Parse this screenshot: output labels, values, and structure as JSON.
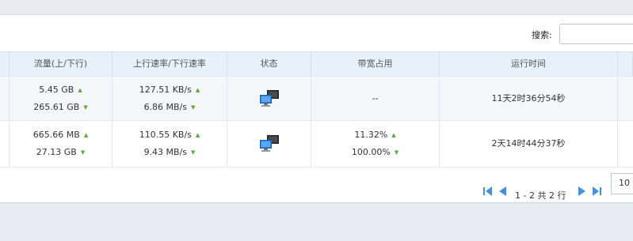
{
  "search": {
    "label": "搜索:",
    "value": ""
  },
  "table": {
    "headers": [
      "流量(上/下行)",
      "上行速率/下行速率",
      "状态",
      "带宽占用",
      "运行时间"
    ],
    "rows": [
      {
        "traffic_up": "5.45 GB",
        "traffic_down": "265.61 GB",
        "rate_up": "127.51 KB/s",
        "rate_down": "6.86 MB/s",
        "status_icon": "network-computers-icon",
        "bandwidth": "--",
        "uptime": "11天2时36分54秒"
      },
      {
        "traffic_up": "665.66 MB",
        "traffic_down": "27.13 GB",
        "rate_up": "110.55 KB/s",
        "rate_down": "9.43 MB/s",
        "status_icon": "network-computers-icon",
        "bandwidth_up": "11.32%",
        "bandwidth_down": "100.00%",
        "uptime": "2天14时44分37秒"
      }
    ]
  },
  "pagination": {
    "info": "1 - 2 共 2 行",
    "page_size": "10"
  },
  "colors": {
    "header_bg": "#e6f1fb",
    "arrow": "#5ea83a",
    "pager_arrow": "#4a90d9"
  }
}
